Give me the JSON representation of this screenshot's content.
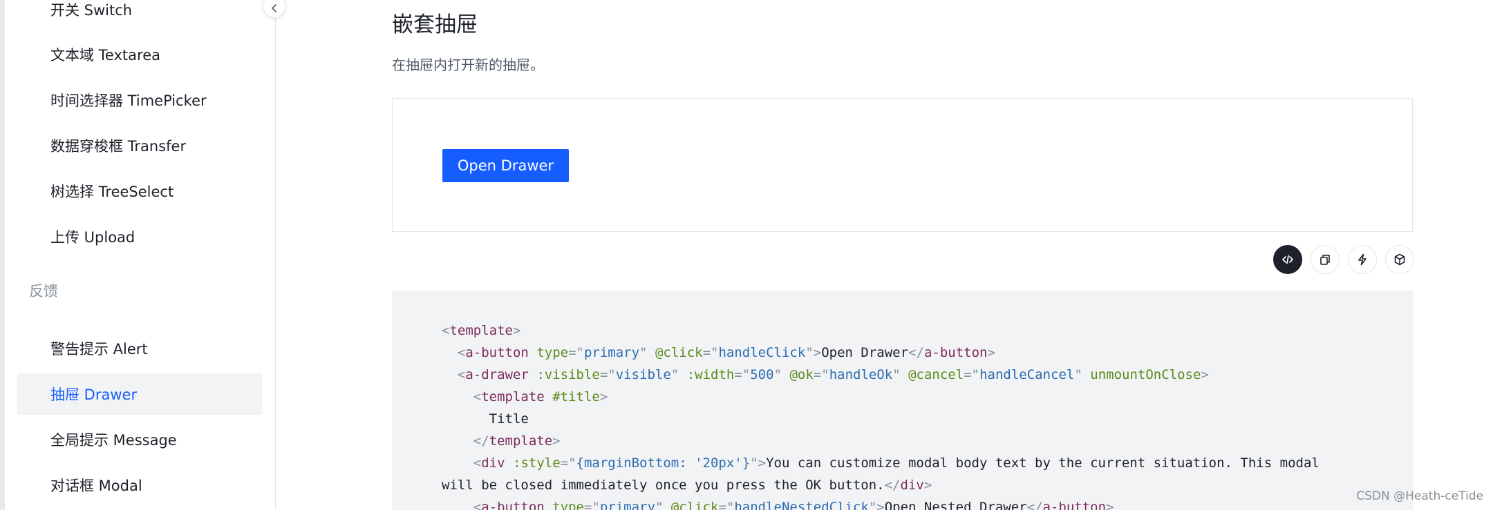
{
  "sidebar": {
    "items": [
      {
        "label": "开关 Switch",
        "active": false
      },
      {
        "label": "文本域 Textarea",
        "active": false
      },
      {
        "label": "时间选择器 TimePicker",
        "active": false
      },
      {
        "label": "数据穿梭框 Transfer",
        "active": false
      },
      {
        "label": "树选择 TreeSelect",
        "active": false
      },
      {
        "label": "上传 Upload",
        "active": false
      }
    ],
    "group_label": "反馈",
    "group_items": [
      {
        "label": "警告提示 Alert",
        "active": false
      },
      {
        "label": "抽屉 Drawer",
        "active": true
      },
      {
        "label": "全局提示 Message",
        "active": false
      },
      {
        "label": "对话框 Modal",
        "active": false
      }
    ],
    "collapse_icon": "chevron-left-icon"
  },
  "main": {
    "title": "嵌套抽屉",
    "description": "在抽屉内打开新的抽屉。",
    "demo": {
      "button_label": "Open Drawer"
    },
    "toolbar": [
      {
        "icon": "code-icon",
        "active": true
      },
      {
        "icon": "copy-icon",
        "active": false
      },
      {
        "icon": "lightning-icon",
        "active": false
      },
      {
        "icon": "codesandbox-icon",
        "active": false
      }
    ],
    "code": {
      "l1_tag": "template",
      "l2_tag": "a-button",
      "l2_attr1": "type",
      "l2_val1": "primary",
      "l2_attr2": "@click",
      "l2_val2": "handleClick",
      "l2_text": "Open Drawer",
      "l3_tag": "a-drawer",
      "l3_attr1": ":visible",
      "l3_val1": "visible",
      "l3_attr2": ":width",
      "l3_val2": "500",
      "l3_attr3": "@ok",
      "l3_val3": "handleOk",
      "l3_attr4": "@cancel",
      "l3_val4": "handleCancel",
      "l3_attr5": "unmountOnClose",
      "l4_tag": "template",
      "l4_attr": "#title",
      "l5_text": "Title",
      "l6_tag": "template",
      "l7_tag": "div",
      "l7_attr": ":style",
      "l7_val": "{marginBottom: '20px'}",
      "l7_text": "You can customize modal body text by the current situation. This modal",
      "l8_text": "will be closed immediately once you press the OK button.",
      "l8_tag": "div",
      "l9_tag": "a-button",
      "l9_attr1": "type",
      "l9_val1": "primary",
      "l9_attr2": "@click",
      "l9_val2": "handleNestedClick",
      "l9_text": "Open Nested Drawer"
    }
  },
  "watermark": "CSDN @Heath-ceTide",
  "colors": {
    "accent": "#165dff",
    "active_bg": "#f2f3f5",
    "code_bg": "#f2f3f5"
  }
}
